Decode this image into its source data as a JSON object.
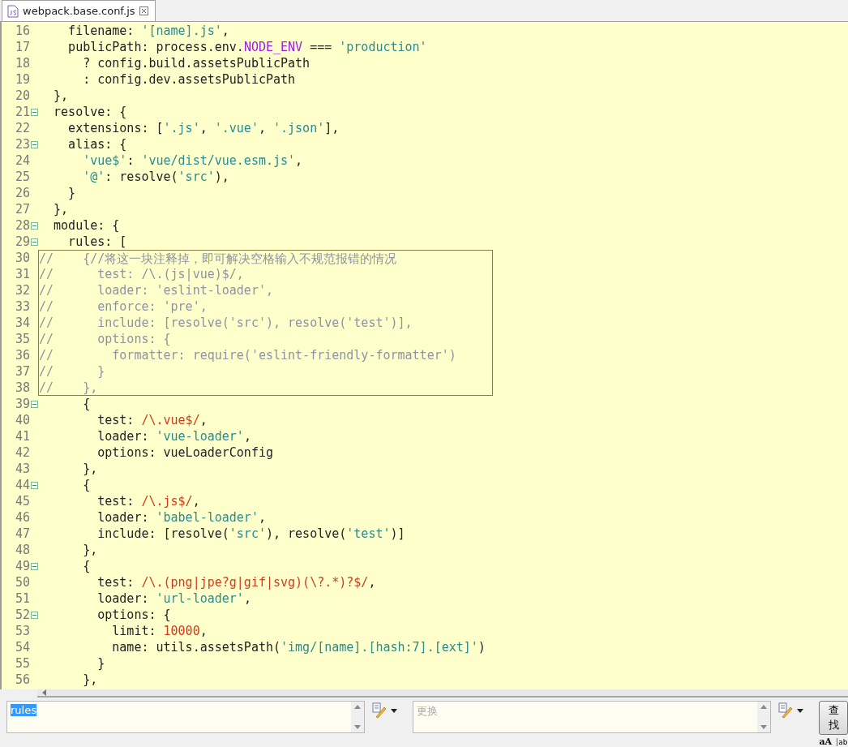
{
  "tab": {
    "title": "webpack.base.conf.js",
    "selected": true
  },
  "lines": [
    {
      "number": "16",
      "fold": false,
      "boxed": false,
      "tokens": [
        {
          "kind": "plain",
          "text": "    filename: "
        },
        {
          "kind": "string",
          "text": "'[name].js'"
        },
        {
          "kind": "plain",
          "text": ","
        }
      ]
    },
    {
      "number": "17",
      "fold": false,
      "boxed": false,
      "tokens": [
        {
          "kind": "plain",
          "text": "    publicPath: process.env."
        },
        {
          "kind": "keyword",
          "text": "NODE_ENV"
        },
        {
          "kind": "plain",
          "text": " === "
        },
        {
          "kind": "string",
          "text": "'production'"
        }
      ]
    },
    {
      "number": "18",
      "fold": false,
      "boxed": false,
      "tokens": [
        {
          "kind": "plain",
          "text": "      ? config.build.assetsPublicPath"
        }
      ]
    },
    {
      "number": "19",
      "fold": false,
      "boxed": false,
      "tokens": [
        {
          "kind": "plain",
          "text": "      : config.dev.assetsPublicPath"
        }
      ]
    },
    {
      "number": "20",
      "fold": false,
      "boxed": false,
      "tokens": [
        {
          "kind": "plain",
          "text": "  },"
        }
      ]
    },
    {
      "number": "21",
      "fold": true,
      "boxed": false,
      "tokens": [
        {
          "kind": "plain",
          "text": "  resolve: {"
        }
      ]
    },
    {
      "number": "22",
      "fold": false,
      "boxed": false,
      "tokens": [
        {
          "kind": "plain",
          "text": "    extensions: ["
        },
        {
          "kind": "string",
          "text": "'.js'"
        },
        {
          "kind": "plain",
          "text": ", "
        },
        {
          "kind": "string",
          "text": "'.vue'"
        },
        {
          "kind": "plain",
          "text": ", "
        },
        {
          "kind": "string",
          "text": "'.json'"
        },
        {
          "kind": "plain",
          "text": "],"
        }
      ]
    },
    {
      "number": "23",
      "fold": true,
      "boxed": false,
      "tokens": [
        {
          "kind": "plain",
          "text": "    alias: {"
        }
      ]
    },
    {
      "number": "24",
      "fold": false,
      "boxed": false,
      "tokens": [
        {
          "kind": "string",
          "text": "      'vue$'"
        },
        {
          "kind": "plain",
          "text": ": "
        },
        {
          "kind": "string",
          "text": "'vue/dist/vue.esm.js'"
        },
        {
          "kind": "plain",
          "text": ","
        }
      ]
    },
    {
      "number": "25",
      "fold": false,
      "boxed": false,
      "tokens": [
        {
          "kind": "string",
          "text": "      '@'"
        },
        {
          "kind": "plain",
          "text": ": resolve("
        },
        {
          "kind": "string",
          "text": "'src'"
        },
        {
          "kind": "plain",
          "text": "),"
        }
      ]
    },
    {
      "number": "26",
      "fold": false,
      "boxed": false,
      "tokens": [
        {
          "kind": "plain",
          "text": "    }"
        }
      ]
    },
    {
      "number": "27",
      "fold": false,
      "boxed": false,
      "tokens": [
        {
          "kind": "plain",
          "text": "  },"
        }
      ]
    },
    {
      "number": "28",
      "fold": true,
      "boxed": false,
      "tokens": [
        {
          "kind": "plain",
          "text": "  module: {"
        }
      ]
    },
    {
      "number": "29",
      "fold": true,
      "boxed": false,
      "tokens": [
        {
          "kind": "plain",
          "text": "    rules: ["
        }
      ]
    },
    {
      "number": "30",
      "fold": false,
      "boxed": true,
      "tokens": [
        {
          "kind": "comment",
          "text": "//    {//将这一块注释掉，即可解决空格输入不规范报错的情况"
        }
      ]
    },
    {
      "number": "31",
      "fold": false,
      "boxed": true,
      "tokens": [
        {
          "kind": "comment",
          "text": "//      test: /\\.(js|vue)$/,"
        }
      ]
    },
    {
      "number": "32",
      "fold": false,
      "boxed": true,
      "tokens": [
        {
          "kind": "comment",
          "text": "//      loader: 'eslint-loader',"
        }
      ]
    },
    {
      "number": "33",
      "fold": false,
      "boxed": true,
      "tokens": [
        {
          "kind": "comment",
          "text": "//      enforce: 'pre',"
        }
      ]
    },
    {
      "number": "34",
      "fold": false,
      "boxed": true,
      "tokens": [
        {
          "kind": "comment",
          "text": "//      include: [resolve('src'), resolve('test')],"
        }
      ]
    },
    {
      "number": "35",
      "fold": false,
      "boxed": true,
      "tokens": [
        {
          "kind": "comment",
          "text": "//      options: {"
        }
      ]
    },
    {
      "number": "36",
      "fold": false,
      "boxed": true,
      "tokens": [
        {
          "kind": "comment",
          "text": "//        formatter: require('eslint-friendly-formatter')"
        }
      ]
    },
    {
      "number": "37",
      "fold": false,
      "boxed": true,
      "tokens": [
        {
          "kind": "comment",
          "text": "//      }"
        }
      ]
    },
    {
      "number": "38",
      "fold": false,
      "boxed": true,
      "tokens": [
        {
          "kind": "comment",
          "text": "//    },"
        }
      ]
    },
    {
      "number": "39",
      "fold": true,
      "boxed": false,
      "tokens": [
        {
          "kind": "plain",
          "text": "      {"
        }
      ]
    },
    {
      "number": "40",
      "fold": false,
      "boxed": false,
      "tokens": [
        {
          "kind": "plain",
          "text": "        test: "
        },
        {
          "kind": "regex",
          "text": "/\\.vue$/"
        },
        {
          "kind": "plain",
          "text": ","
        }
      ]
    },
    {
      "number": "41",
      "fold": false,
      "boxed": false,
      "tokens": [
        {
          "kind": "plain",
          "text": "        loader: "
        },
        {
          "kind": "string",
          "text": "'vue-loader'"
        },
        {
          "kind": "plain",
          "text": ","
        }
      ]
    },
    {
      "number": "42",
      "fold": false,
      "boxed": false,
      "tokens": [
        {
          "kind": "plain",
          "text": "        options: vueLoaderConfig"
        }
      ]
    },
    {
      "number": "43",
      "fold": false,
      "boxed": false,
      "tokens": [
        {
          "kind": "plain",
          "text": "      },"
        }
      ]
    },
    {
      "number": "44",
      "fold": true,
      "boxed": false,
      "tokens": [
        {
          "kind": "plain",
          "text": "      {"
        }
      ]
    },
    {
      "number": "45",
      "fold": false,
      "boxed": false,
      "tokens": [
        {
          "kind": "plain",
          "text": "        test: "
        },
        {
          "kind": "regex",
          "text": "/\\.js$/"
        },
        {
          "kind": "plain",
          "text": ","
        }
      ]
    },
    {
      "number": "46",
      "fold": false,
      "boxed": false,
      "tokens": [
        {
          "kind": "plain",
          "text": "        loader: "
        },
        {
          "kind": "string",
          "text": "'babel-loader'"
        },
        {
          "kind": "plain",
          "text": ","
        }
      ]
    },
    {
      "number": "47",
      "fold": false,
      "boxed": false,
      "tokens": [
        {
          "kind": "plain",
          "text": "        include: [resolve("
        },
        {
          "kind": "string",
          "text": "'src'"
        },
        {
          "kind": "plain",
          "text": "), resolve("
        },
        {
          "kind": "string",
          "text": "'test'"
        },
        {
          "kind": "plain",
          "text": ")]"
        }
      ]
    },
    {
      "number": "48",
      "fold": false,
      "boxed": false,
      "tokens": [
        {
          "kind": "plain",
          "text": "      },"
        }
      ]
    },
    {
      "number": "49",
      "fold": true,
      "boxed": false,
      "tokens": [
        {
          "kind": "plain",
          "text": "      {"
        }
      ]
    },
    {
      "number": "50",
      "fold": false,
      "boxed": false,
      "tokens": [
        {
          "kind": "plain",
          "text": "        test: "
        },
        {
          "kind": "regex",
          "text": "/\\.(png|jpe?g|gif|svg)(\\?.*)?$/"
        },
        {
          "kind": "plain",
          "text": ","
        }
      ]
    },
    {
      "number": "51",
      "fold": false,
      "boxed": false,
      "tokens": [
        {
          "kind": "plain",
          "text": "        loader: "
        },
        {
          "kind": "string",
          "text": "'url-loader'"
        },
        {
          "kind": "plain",
          "text": ","
        }
      ]
    },
    {
      "number": "52",
      "fold": true,
      "boxed": false,
      "tokens": [
        {
          "kind": "plain",
          "text": "        options: {"
        }
      ]
    },
    {
      "number": "53",
      "fold": false,
      "boxed": false,
      "tokens": [
        {
          "kind": "plain",
          "text": "          limit: "
        },
        {
          "kind": "number",
          "text": "10000"
        },
        {
          "kind": "plain",
          "text": ","
        }
      ]
    },
    {
      "number": "54",
      "fold": false,
      "boxed": false,
      "tokens": [
        {
          "kind": "plain",
          "text": "          name: utils.assetsPath("
        },
        {
          "kind": "string",
          "text": "'img/[name].[hash:7].[ext]'"
        },
        {
          "kind": "plain",
          "text": ")"
        }
      ]
    },
    {
      "number": "55",
      "fold": false,
      "boxed": false,
      "tokens": [
        {
          "kind": "plain",
          "text": "        }"
        }
      ]
    },
    {
      "number": "56",
      "fold": false,
      "boxed": false,
      "tokens": [
        {
          "kind": "plain",
          "text": "      },"
        }
      ]
    }
  ],
  "find_bar": {
    "find": {
      "value": "rules",
      "selected": true
    },
    "replace": {
      "placeholder": "更换"
    },
    "find_button": "查找",
    "case_toggle": "aA",
    "word_toggle": "ab"
  }
}
